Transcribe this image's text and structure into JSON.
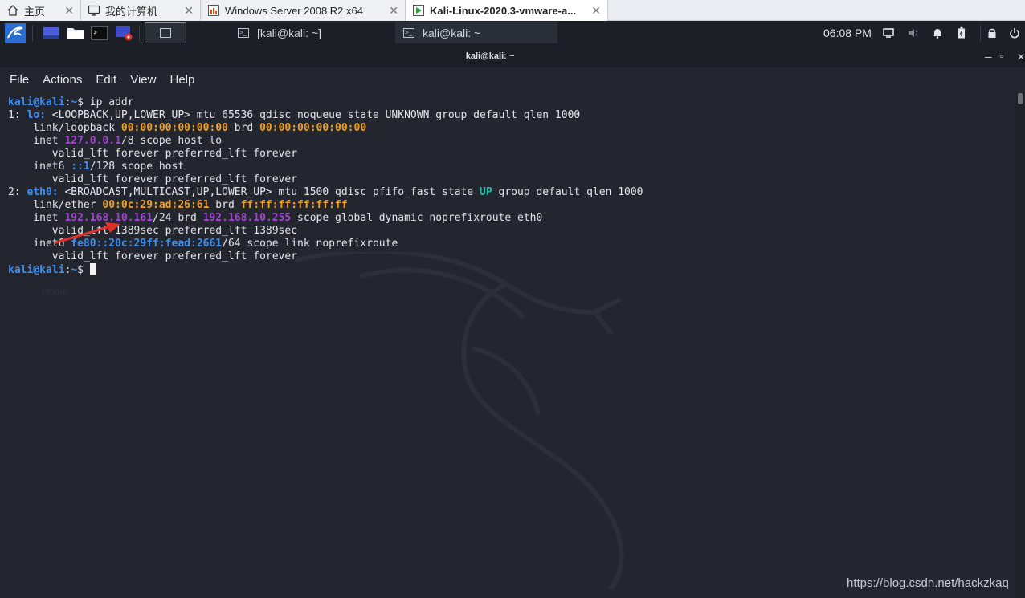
{
  "vmware_tabs": [
    {
      "label": "主页",
      "icon": "home-icon"
    },
    {
      "label": "我的计算机",
      "icon": "computer-icon"
    },
    {
      "label": "Windows Server 2008 R2 x64",
      "icon": "vm-icon"
    },
    {
      "label": "Kali-Linux-2020.3-vmware-a...",
      "icon": "vm-running-icon",
      "active": true
    }
  ],
  "panel": {
    "window_buttons": [
      "[kali@kali: ~]",
      "kali@kali: ~"
    ],
    "clock": "06:08 PM"
  },
  "terminal": {
    "title": "kali@kali: ~",
    "menu": [
      "File",
      "Actions",
      "Edit",
      "View",
      "Help"
    ],
    "lines": [
      [
        {
          "t": "kali@kali",
          "c": "blue"
        },
        {
          "t": ":",
          "c": "white"
        },
        {
          "t": "~",
          "c": "blue"
        },
        {
          "t": "$ ip addr",
          "c": "white"
        }
      ],
      [
        {
          "t": "1: ",
          "c": "white"
        },
        {
          "t": "lo:",
          "c": "blue"
        },
        {
          "t": " <LOOPBACK,UP,LOWER_UP> mtu 65536 qdisc noqueue state UNKNOWN group default qlen 1000",
          "c": "white"
        }
      ],
      [
        {
          "t": "    link/loopback ",
          "c": "white"
        },
        {
          "t": "00:00:00:00:00:00",
          "c": "orange"
        },
        {
          "t": " brd ",
          "c": "white"
        },
        {
          "t": "00:00:00:00:00:00",
          "c": "orange"
        }
      ],
      [
        {
          "t": "    inet ",
          "c": "white"
        },
        {
          "t": "127.0.0.1",
          "c": "purple"
        },
        {
          "t": "/8 scope host lo",
          "c": "white"
        }
      ],
      [
        {
          "t": "       valid_lft forever preferred_lft forever",
          "c": "white"
        }
      ],
      [
        {
          "t": "    inet6 ",
          "c": "white"
        },
        {
          "t": "::1",
          "c": "blue"
        },
        {
          "t": "/128 scope host",
          "c": "white"
        }
      ],
      [
        {
          "t": "       valid_lft forever preferred_lft forever",
          "c": "white"
        }
      ],
      [
        {
          "t": "2: ",
          "c": "white"
        },
        {
          "t": "eth0:",
          "c": "blue"
        },
        {
          "t": " <BROADCAST,MULTICAST,UP,LOWER_UP> mtu 1500 qdisc pfifo_fast state ",
          "c": "white"
        },
        {
          "t": "UP",
          "c": "teal"
        },
        {
          "t": " group default qlen 1000",
          "c": "white"
        }
      ],
      [
        {
          "t": "    link/ether ",
          "c": "white"
        },
        {
          "t": "00:0c:29:ad:26:61",
          "c": "orange"
        },
        {
          "t": " brd ",
          "c": "white"
        },
        {
          "t": "ff:ff:ff:ff:ff:ff",
          "c": "orange"
        }
      ],
      [
        {
          "t": "    inet ",
          "c": "white"
        },
        {
          "t": "192.168.10.161",
          "c": "purple"
        },
        {
          "t": "/24 brd ",
          "c": "white"
        },
        {
          "t": "192.168.10.255",
          "c": "purple"
        },
        {
          "t": " scope global dynamic noprefixroute eth0",
          "c": "white"
        }
      ],
      [
        {
          "t": "       valid_lft 1389sec preferred_lft 1389sec",
          "c": "white"
        }
      ],
      [
        {
          "t": "    inet6 ",
          "c": "white"
        },
        {
          "t": "fe80::20c:29ff:fead:2661",
          "c": "blue"
        },
        {
          "t": "/64 scope link noprefixroute",
          "c": "white"
        }
      ],
      [
        {
          "t": "       valid_lft forever preferred_lft forever",
          "c": "white"
        }
      ],
      [
        {
          "t": "kali@kali",
          "c": "blue"
        },
        {
          "t": ":",
          "c": "white"
        },
        {
          "t": "~",
          "c": "blue"
        },
        {
          "t": "$ ",
          "c": "white"
        }
      ]
    ],
    "ghost_text": "Home"
  },
  "watermark": "https://blog.csdn.net/hackzkaq",
  "colors": {
    "blue": "#3f8ff0",
    "orange": "#f0a020",
    "purple": "#a244d4",
    "teal": "#22c1a6",
    "arrow": "#e0302a"
  }
}
